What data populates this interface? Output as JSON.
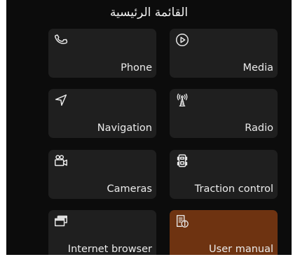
{
  "header": {
    "title": "القائمة الرئيسية"
  },
  "tiles": [
    {
      "label": "Phone",
      "icon": "phone-icon"
    },
    {
      "label": "Media",
      "icon": "play-icon"
    },
    {
      "label": "Navigation",
      "icon": "navigation-arrow-icon"
    },
    {
      "label": "Radio",
      "icon": "radio-tower-icon"
    },
    {
      "label": "Cameras",
      "icon": "camera-icon"
    },
    {
      "label": "Traction control",
      "icon": "traction-control-icon"
    },
    {
      "label": "Internet browser",
      "icon": "browser-windows-icon"
    },
    {
      "label": "User manual",
      "icon": "user-manual-icon"
    }
  ],
  "colors": {
    "background": "#0c0c0c",
    "tile": "#1f1f1f",
    "active_tile": "#6e3311",
    "text": "#ececec"
  }
}
